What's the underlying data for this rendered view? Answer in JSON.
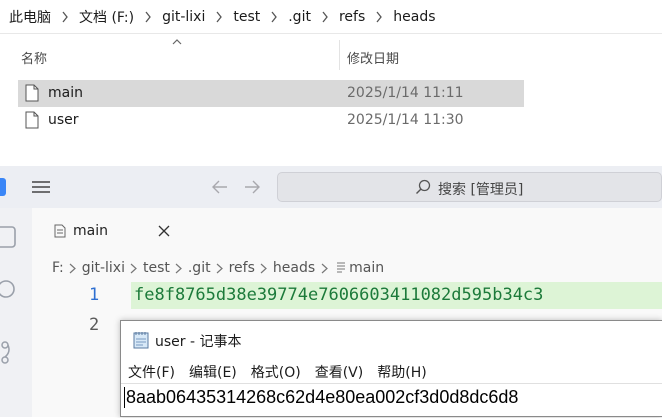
{
  "explorer": {
    "breadcrumb": [
      "此电脑",
      "文档 (F:)",
      "git-lixi",
      "test",
      ".git",
      "refs",
      "heads"
    ],
    "columns": {
      "name": "名称",
      "date_modified": "修改日期"
    },
    "files": [
      {
        "name": "main",
        "date": "2025/1/14 11:11",
        "selected": true
      },
      {
        "name": "user",
        "date": "2025/1/14 11:30",
        "selected": false
      }
    ]
  },
  "editor": {
    "search_placeholder": "搜索 [管理员]",
    "tab": {
      "label": "main"
    },
    "path": [
      "F:",
      "git-lixi",
      "test",
      ".git",
      "refs",
      "heads",
      "main"
    ],
    "lines": [
      {
        "number": "1",
        "text": "fe8f8765d38e39774e7606603411082d595b34c3"
      },
      {
        "number": "2",
        "text": ""
      }
    ]
  },
  "notepad": {
    "title": "user - 记事本",
    "menus": [
      "文件(F)",
      "编辑(E)",
      "格式(O)",
      "查看(V)",
      "帮助(H)"
    ],
    "content": "8aab06435314268c62d4e80ea002cf3d0d8dc6d8"
  },
  "colors": {
    "selection": "#d9d9d9",
    "line_highlight": "#ddf4d6",
    "hash_text": "#1c7a3a",
    "line_number_active": "#2e6fd1"
  }
}
